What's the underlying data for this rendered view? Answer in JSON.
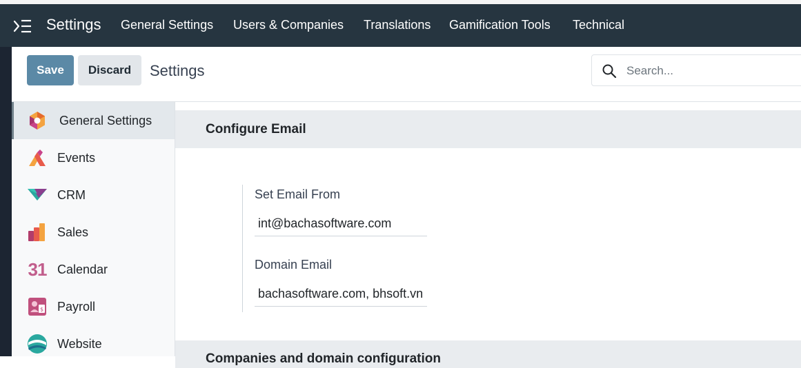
{
  "navbar": {
    "app_title": "Settings",
    "items": [
      {
        "label": "General Settings"
      },
      {
        "label": "Users & Companies"
      },
      {
        "label": "Translations"
      },
      {
        "label": "Gamification Tools"
      },
      {
        "label": "Technical"
      }
    ]
  },
  "control_panel": {
    "save_label": "Save",
    "discard_label": "Discard",
    "breadcrumb": "Settings",
    "search_placeholder": "Search...",
    "search_value": ""
  },
  "sidebar": {
    "items": [
      {
        "label": "General Settings",
        "icon": "general-settings-icon",
        "active": true
      },
      {
        "label": "Events",
        "icon": "events-icon"
      },
      {
        "label": "CRM",
        "icon": "crm-icon"
      },
      {
        "label": "Sales",
        "icon": "sales-icon"
      },
      {
        "label": "Calendar",
        "icon": "calendar-icon",
        "icon_text": "31"
      },
      {
        "label": "Payroll",
        "icon": "payroll-icon"
      },
      {
        "label": "Website",
        "icon": "website-icon"
      }
    ]
  },
  "main": {
    "section_title": "Configure Email",
    "email_from_label": "Set Email From",
    "email_from_value": "int@bachasoftware.com",
    "domain_email_label": "Domain Email",
    "domain_email_value": "bachasoftware.com, bhsoft.vn",
    "next_section_title": "Companies and domain configuration"
  },
  "colors": {
    "navbar_bg": "#263540",
    "save_button": "#5b89a6",
    "discard_button": "#e2e6ea",
    "active_sidebar": "#e3e8ec"
  }
}
